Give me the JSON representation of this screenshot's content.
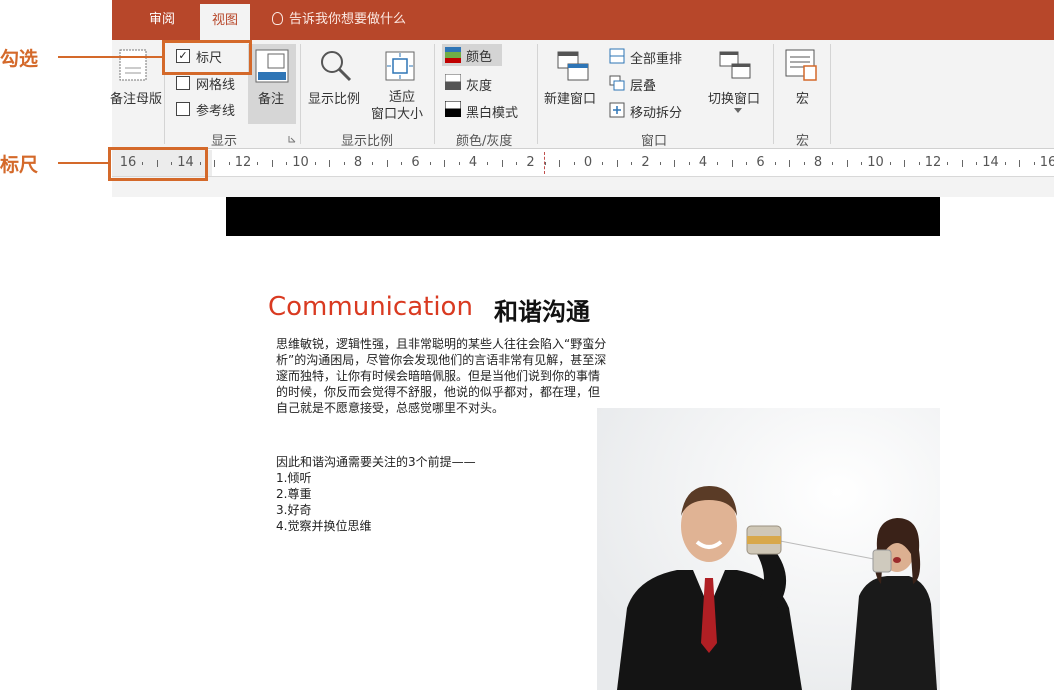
{
  "ribbon": {
    "tabs": [
      {
        "label": "审阅"
      },
      {
        "label": "视图"
      }
    ],
    "tell_me": "告诉我你想要做什么",
    "notes_master_label": "备注母版",
    "show_group": {
      "ruler_label": "标尺",
      "ruler_checked": "✓",
      "gridlines_label": "网格线",
      "guides_label": "参考线",
      "notes_label": "备注",
      "group_label": "显示"
    },
    "zoom_group": {
      "zoom_label": "显示比例",
      "fit_label_1": "适应",
      "fit_label_2": "窗口大小",
      "group_label": "显示比例"
    },
    "color_group": {
      "color_label": "颜色",
      "grayscale_label": "灰度",
      "bw_label": "黑白模式",
      "group_label": "颜色/灰度"
    },
    "window_group": {
      "new_window_label": "新建窗口",
      "arrange_all_label": "全部重排",
      "cascade_label": "层叠",
      "move_split_label": "移动拆分",
      "switch_window_label": "切换窗口",
      "group_label": "窗口"
    },
    "macro_group": {
      "macro_label": "宏",
      "group_label": "宏"
    }
  },
  "ruler": {
    "labels": [
      "16",
      "14",
      "12",
      "10",
      "8",
      "6",
      "4",
      "2",
      "0",
      "2",
      "4",
      "6",
      "8",
      "10",
      "12",
      "14",
      "16"
    ]
  },
  "annotations": {
    "check_label": "勾选",
    "ruler_label": "标尺"
  },
  "slide": {
    "title_en": "Communication",
    "title_cn": "和谐沟通",
    "paragraph_lines": [
      "思维敏锐，逻辑性强，且非常聪明的某些人往往会陷入“野蛮分",
      "析”的沟通困局，尽管你会发现他们的言语非常有见解，甚至深",
      "邃而独特，让你有时候会暗暗佩服。但是当他们说到你的事情",
      "的时候，你反而会觉得不舒服，他说的似乎都对，都在理，但",
      "自己就是不愿意接受，总感觉哪里不对头。"
    ],
    "list_intro": "因此和谐沟通需要关注的3个前提——",
    "list_items": [
      "1.倾听",
      "2.尊重",
      "3.好奇",
      "4.觉察并换位思维"
    ]
  },
  "colors": {
    "tab_bar": "#b7472a",
    "accent_orange": "#d4692a",
    "title_red": "#d93a21"
  }
}
